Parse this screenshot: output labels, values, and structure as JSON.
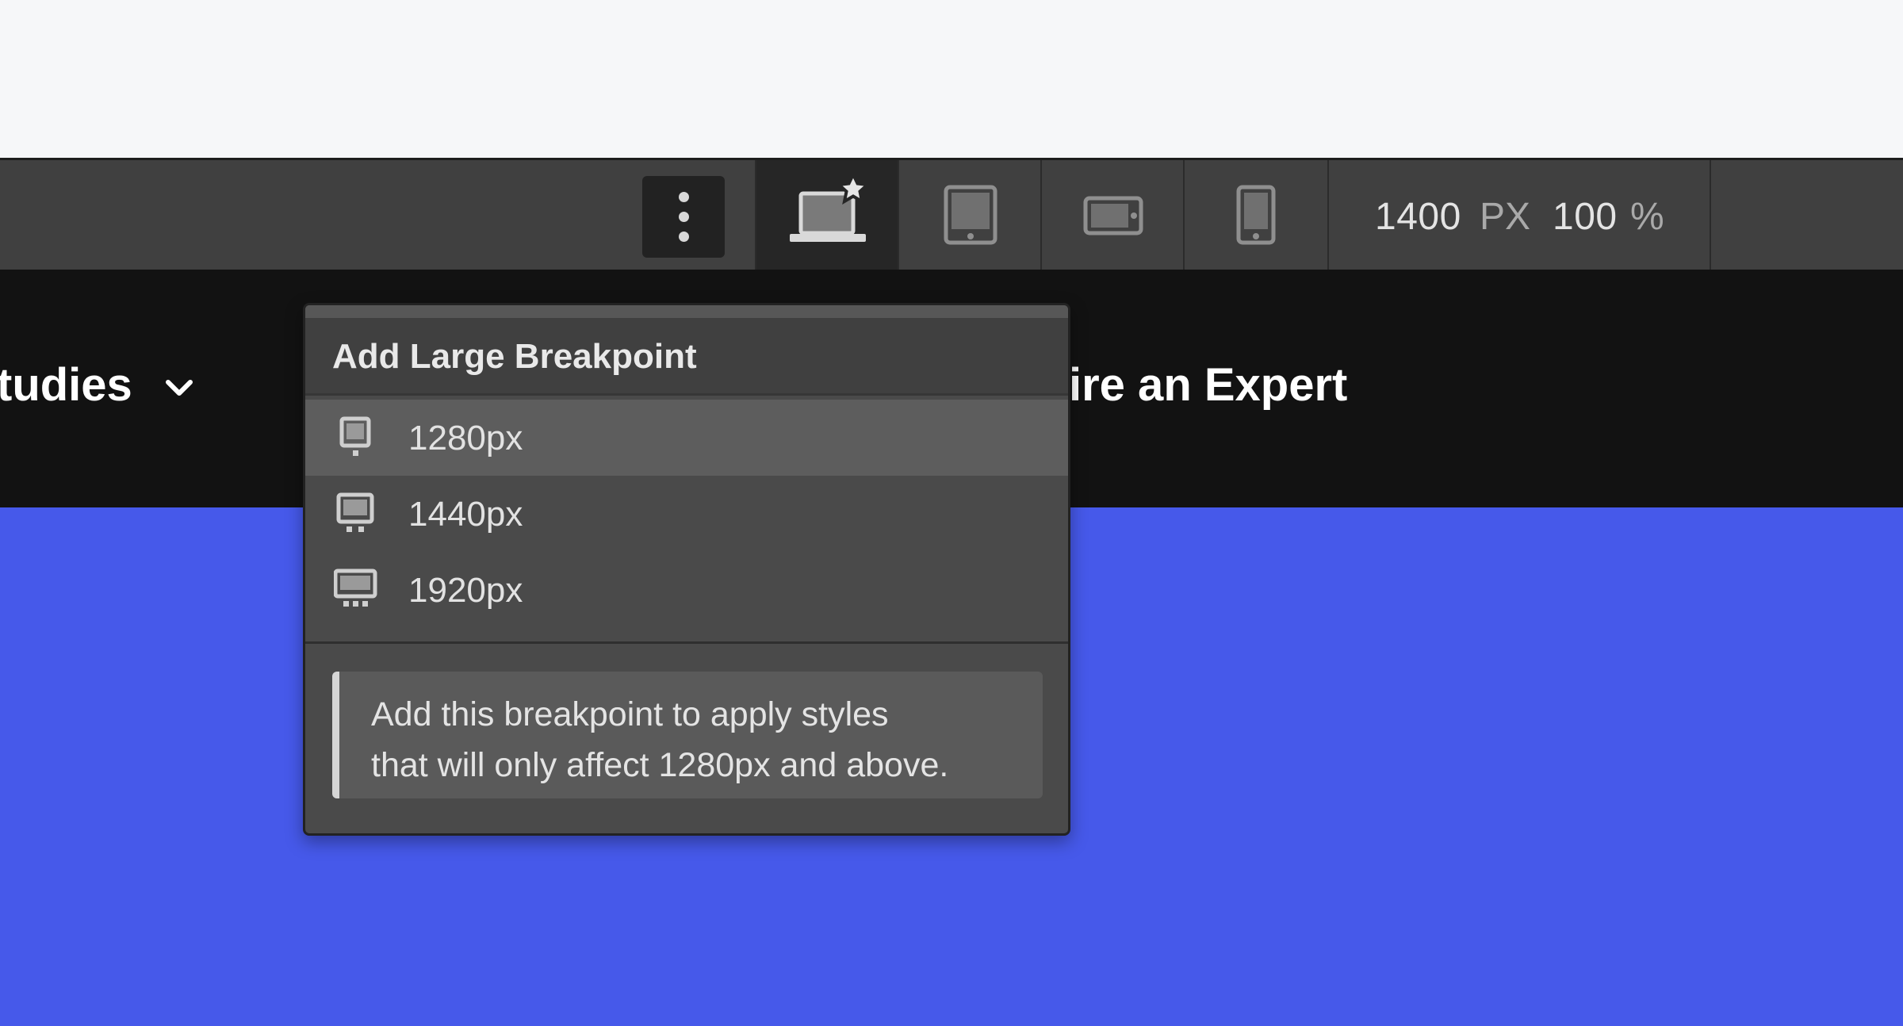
{
  "toolbar": {
    "more_icon": "vertical-dots-icon",
    "devices": [
      {
        "name": "desktop-star",
        "icon": "laptop-star-icon",
        "active": true
      },
      {
        "name": "tablet",
        "icon": "tablet-icon",
        "active": false
      },
      {
        "name": "mobile-landscape",
        "icon": "mobile-landscape-icon",
        "active": false
      },
      {
        "name": "mobile-portrait",
        "icon": "mobile-portrait-icon",
        "active": false
      }
    ],
    "width_value": "1400",
    "width_unit": "PX",
    "zoom_value": "100",
    "zoom_unit": "%"
  },
  "nav": {
    "left_link": "tudies",
    "right_link": "ire an Expert"
  },
  "popup": {
    "title": "Add Large Breakpoint",
    "items": [
      {
        "label": "1280px",
        "icon": "monitor-small-icon"
      },
      {
        "label": "1440px",
        "icon": "monitor-medium-icon"
      },
      {
        "label": "1920px",
        "icon": "monitor-large-icon"
      }
    ],
    "note_line1": "Add this breakpoint to apply styles",
    "note_line2": "that will only affect 1280px and above."
  },
  "colors": {
    "toolbar_bg": "#404040",
    "nav_bg": "#121212",
    "hero_bg": "#4659ea",
    "popup_bg": "#4a4a4a",
    "hover_bg": "#5d5d5d"
  }
}
